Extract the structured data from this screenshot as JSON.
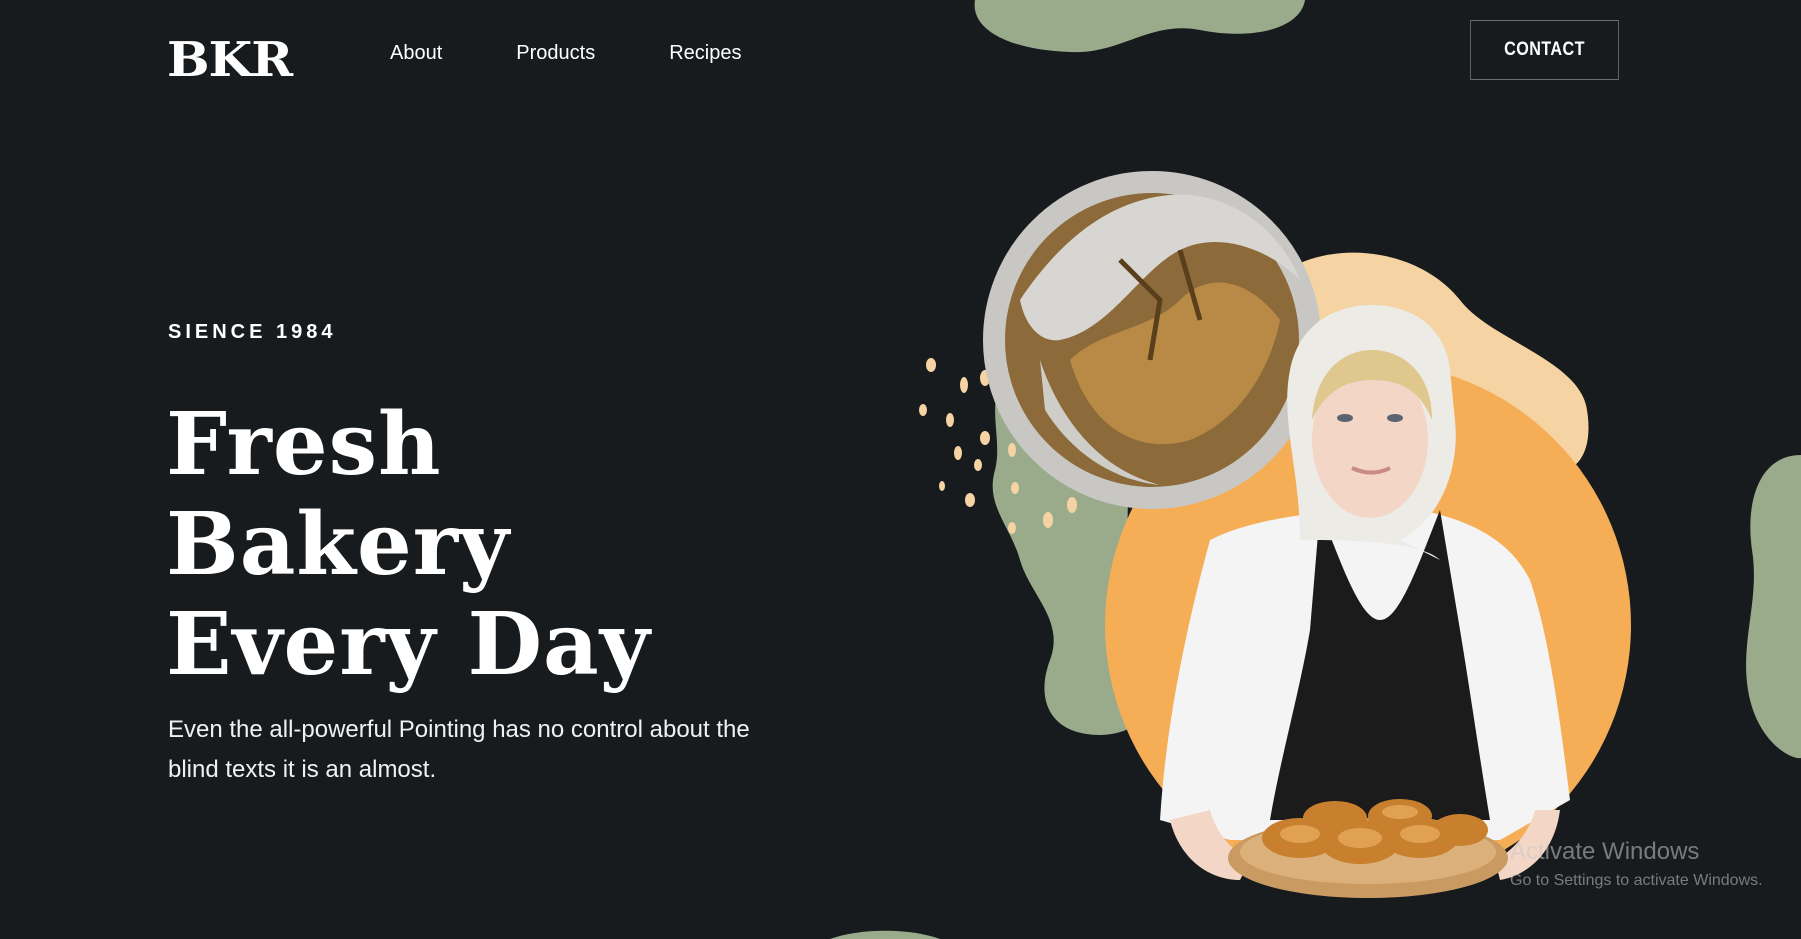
{
  "header": {
    "logo": "BKR",
    "nav": [
      {
        "label": "About"
      },
      {
        "label": "Products"
      },
      {
        "label": "Recipes"
      }
    ],
    "contact_label": "CONTACT"
  },
  "hero": {
    "eyebrow": "SIENCE 1984",
    "headline": [
      "Fresh",
      "Bakery",
      "Every Day"
    ],
    "subtext": "Even the all-powerful Pointing has no control about the blind texts it is an almost."
  },
  "watermark": {
    "title": "Activate Windows",
    "subtitle": "Go to Settings to activate Windows."
  },
  "colors": {
    "background": "#181b1d",
    "sage": "#9aab8c",
    "orange": "#f5ad56",
    "peach": "#f6d3a2",
    "text": "#ffffff"
  }
}
